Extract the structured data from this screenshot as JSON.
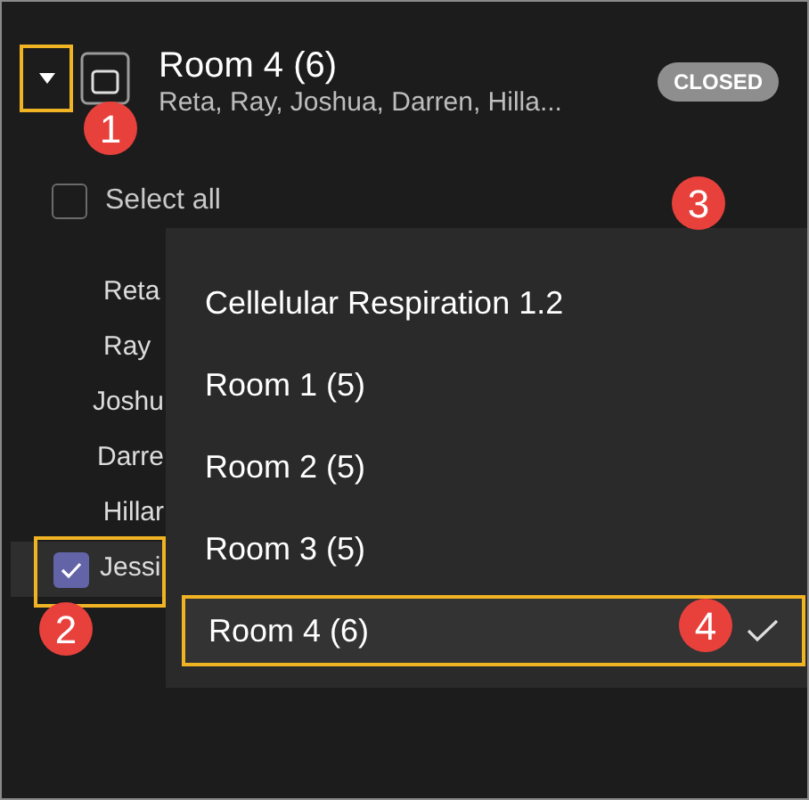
{
  "room": {
    "title": "Room 4 (6)",
    "members": "Reta, Ray, Joshua, Darren, Hilla...",
    "status": "CLOSED",
    "expanded": true
  },
  "select_all": {
    "label": "Select all",
    "checked": false
  },
  "participants": [
    {
      "name": "Reta",
      "checked": false
    },
    {
      "name": "Ray",
      "checked": false
    },
    {
      "name": "Joshu",
      "checked": false
    },
    {
      "name": "Darre",
      "checked": false
    },
    {
      "name": "Hillar",
      "checked": false
    },
    {
      "name": "Jessi",
      "checked": true
    }
  ],
  "move_menu": [
    {
      "label": "Cellelular Respiration 1.2",
      "selected": false
    },
    {
      "label": "Room 1 (5)",
      "selected": false
    },
    {
      "label": "Room 2 (5)",
      "selected": false
    },
    {
      "label": "Room 3 (5)",
      "selected": false
    },
    {
      "label": "Room 4 (6)",
      "selected": true
    }
  ],
  "callouts": [
    "1",
    "2",
    "3",
    "4"
  ]
}
